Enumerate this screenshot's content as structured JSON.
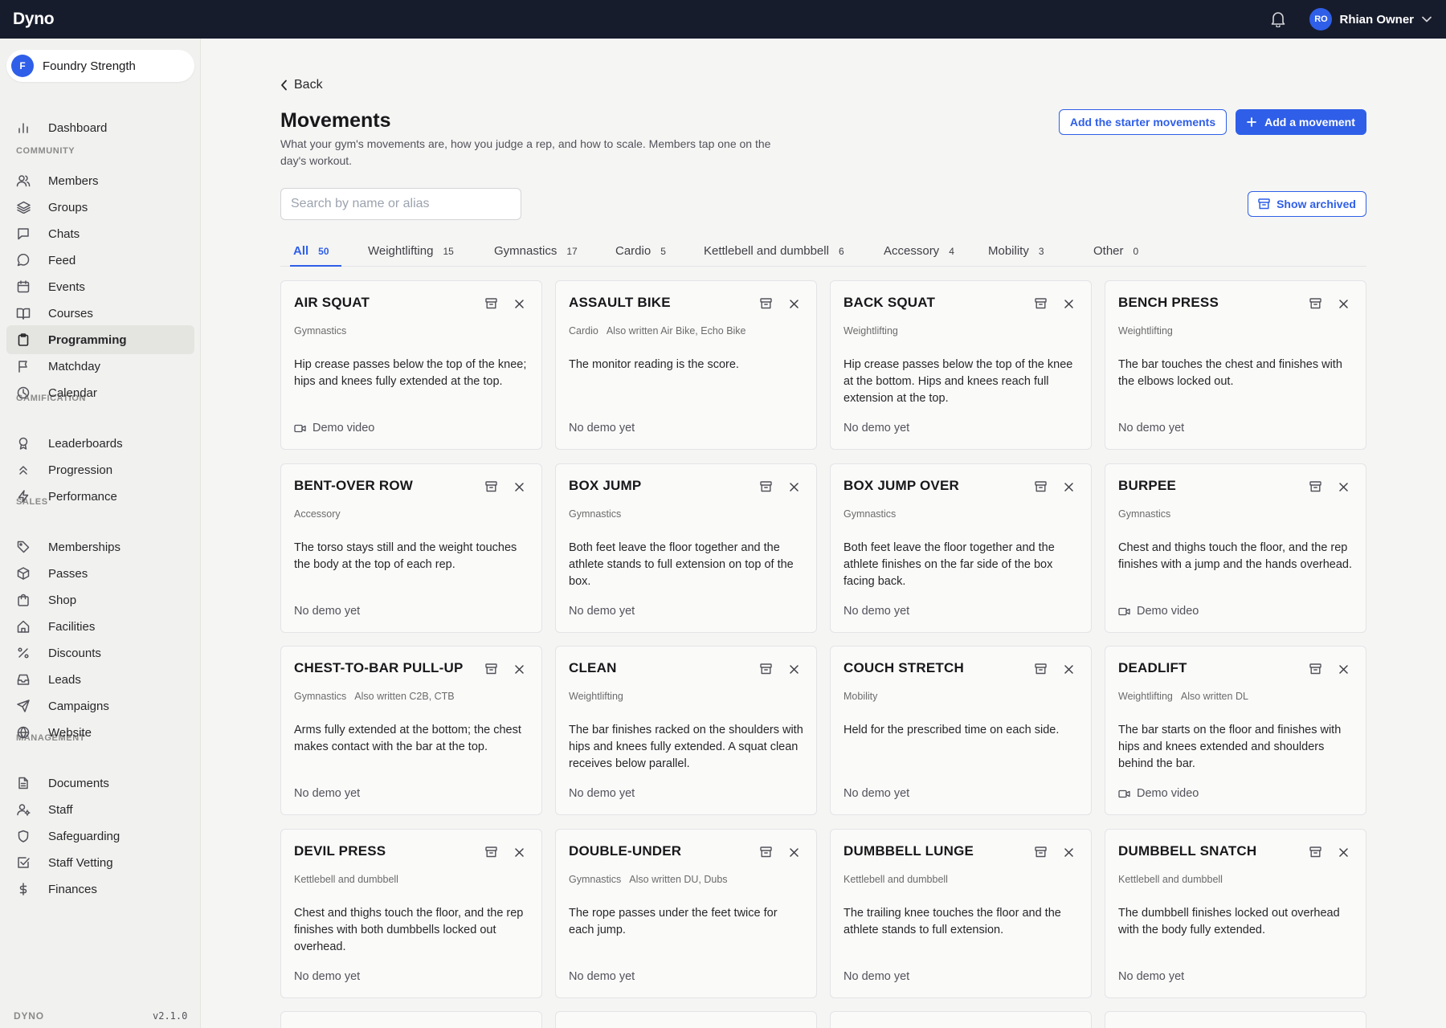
{
  "app": {
    "brand": "Dyno"
  },
  "user": {
    "initials": "RO",
    "name": "Rhian Owner"
  },
  "org": {
    "initial": "F",
    "name": "Foundry Strength"
  },
  "sidebar": {
    "sections": [
      {
        "label": "COMMUNITY"
      },
      {
        "label": "GAMIFICATION"
      },
      {
        "label": "SALES"
      },
      {
        "label": "MANAGEMENT"
      }
    ],
    "items": [
      {
        "label": "Dashboard",
        "icon": "bar-chart-icon"
      },
      {
        "label": "Members",
        "icon": "users-icon"
      },
      {
        "label": "Groups",
        "icon": "layers-icon"
      },
      {
        "label": "Chats",
        "icon": "message-square-icon"
      },
      {
        "label": "Feed",
        "icon": "message-circle-icon"
      },
      {
        "label": "Events",
        "icon": "calendar-icon"
      },
      {
        "label": "Courses",
        "icon": "book-open-icon"
      },
      {
        "label": "Programming",
        "icon": "clipboard-icon"
      },
      {
        "label": "Matchday",
        "icon": "flag-icon"
      },
      {
        "label": "Calendar",
        "icon": "clock-icon"
      },
      {
        "label": "Leaderboards",
        "icon": "award-icon"
      },
      {
        "label": "Progression",
        "icon": "chevrons-up-icon"
      },
      {
        "label": "Performance",
        "icon": "zap-icon"
      },
      {
        "label": "Memberships",
        "icon": "tag-icon"
      },
      {
        "label": "Passes",
        "icon": "package-icon"
      },
      {
        "label": "Shop",
        "icon": "shopping-bag-icon"
      },
      {
        "label": "Facilities",
        "icon": "home-icon"
      },
      {
        "label": "Discounts",
        "icon": "percent-icon"
      },
      {
        "label": "Leads",
        "icon": "inbox-icon"
      },
      {
        "label": "Campaigns",
        "icon": "send-icon"
      },
      {
        "label": "Website",
        "icon": "globe-icon"
      },
      {
        "label": "Documents",
        "icon": "file-text-icon"
      },
      {
        "label": "Staff",
        "icon": "user-cog-icon"
      },
      {
        "label": "Safeguarding",
        "icon": "shield-icon"
      },
      {
        "label": "Staff Vetting",
        "icon": "check-square-icon"
      },
      {
        "label": "Finances",
        "icon": "dollar-icon"
      }
    ],
    "footer_left": "DYNO",
    "footer_right": "v2.1.0"
  },
  "page": {
    "back_label": "Back",
    "title": "Movements",
    "subtitle": "What your gym's movements are, how you judge a rep, and how to scale. Members tap one on the day's workout.",
    "add_starter_label": "Add the starter movements",
    "add_movement_label": "Add a movement",
    "search_placeholder": "Search by name or alias",
    "show_archived_label": "Show archived"
  },
  "tabs": [
    {
      "label": "All",
      "count": "50"
    },
    {
      "label": "Weightlifting",
      "count": "15"
    },
    {
      "label": "Gymnastics",
      "count": "17"
    },
    {
      "label": "Cardio",
      "count": "5"
    },
    {
      "label": "Kettlebell and dumbbell",
      "count": "6"
    },
    {
      "label": "Accessory",
      "count": "4"
    },
    {
      "label": "Mobility",
      "count": "3"
    },
    {
      "label": "Other",
      "count": "0"
    }
  ],
  "cards": [
    {
      "title": "AIR SQUAT",
      "category": "Gymnastics",
      "alias": "",
      "desc": "Hip crease passes below the top of the knee; hips and knees fully extended at the top.",
      "foot": "Demo video",
      "video": true
    },
    {
      "title": "ASSAULT BIKE",
      "category": "Cardio",
      "alias": "Also written Air Bike, Echo Bike",
      "desc": "The monitor reading is the score.",
      "foot": "No demo yet",
      "video": false
    },
    {
      "title": "BACK SQUAT",
      "category": "Weightlifting",
      "alias": "",
      "desc": "Hip crease passes below the top of the knee at the bottom. Hips and knees reach full extension at the top.",
      "foot": "No demo yet",
      "video": false
    },
    {
      "title": "BENCH PRESS",
      "category": "Weightlifting",
      "alias": "",
      "desc": "The bar touches the chest and finishes with the elbows locked out.",
      "foot": "No demo yet",
      "video": false
    },
    {
      "title": "BENT-OVER ROW",
      "category": "Accessory",
      "alias": "",
      "desc": "The torso stays still and the weight touches the body at the top of each rep.",
      "foot": "No demo yet",
      "video": false
    },
    {
      "title": "BOX JUMP",
      "category": "Gymnastics",
      "alias": "",
      "desc": "Both feet leave the floor together and the athlete stands to full extension on top of the box.",
      "foot": "No demo yet",
      "video": false
    },
    {
      "title": "BOX JUMP OVER",
      "category": "Gymnastics",
      "alias": "",
      "desc": "Both feet leave the floor together and the athlete finishes on the far side of the box facing back.",
      "foot": "No demo yet",
      "video": false
    },
    {
      "title": "BURPEE",
      "category": "Gymnastics",
      "alias": "",
      "desc": "Chest and thighs touch the floor, and the rep finishes with a jump and the hands overhead.",
      "foot": "Demo video",
      "video": true
    },
    {
      "title": "CHEST-TO-BAR PULL-UP",
      "category": "Gymnastics",
      "alias": "Also written C2B, CTB",
      "desc": "Arms fully extended at the bottom; the chest makes contact with the bar at the top.",
      "foot": "No demo yet",
      "video": false
    },
    {
      "title": "CLEAN",
      "category": "Weightlifting",
      "alias": "",
      "desc": "The bar finishes racked on the shoulders with hips and knees fully extended. A squat clean receives below parallel.",
      "foot": "No demo yet",
      "video": false
    },
    {
      "title": "COUCH STRETCH",
      "category": "Mobility",
      "alias": "",
      "desc": "Held for the prescribed time on each side.",
      "foot": "No demo yet",
      "video": false
    },
    {
      "title": "DEADLIFT",
      "category": "Weightlifting",
      "alias": "Also written DL",
      "desc": "The bar starts on the floor and finishes with hips and knees extended and shoulders behind the bar.",
      "foot": "Demo video",
      "video": true
    },
    {
      "title": "DEVIL PRESS",
      "category": "Kettlebell and dumbbell",
      "alias": "",
      "desc": "Chest and thighs touch the floor, and the rep finishes with both dumbbells locked out overhead.",
      "foot": "No demo yet",
      "video": false
    },
    {
      "title": "DOUBLE-UNDER",
      "category": "Gymnastics",
      "alias": "Also written DU, Dubs",
      "desc": "The rope passes under the feet twice for each jump.",
      "foot": "No demo yet",
      "video": false
    },
    {
      "title": "DUMBBELL LUNGE",
      "category": "Kettlebell and dumbbell",
      "alias": "",
      "desc": "The trailing knee touches the floor and the athlete stands to full extension.",
      "foot": "No demo yet",
      "video": false
    },
    {
      "title": "DUMBBELL SNATCH",
      "category": "Kettlebell and dumbbell",
      "alias": "",
      "desc": "The dumbbell finishes locked out overhead with the body fully extended.",
      "foot": "No demo yet",
      "video": false
    }
  ]
}
